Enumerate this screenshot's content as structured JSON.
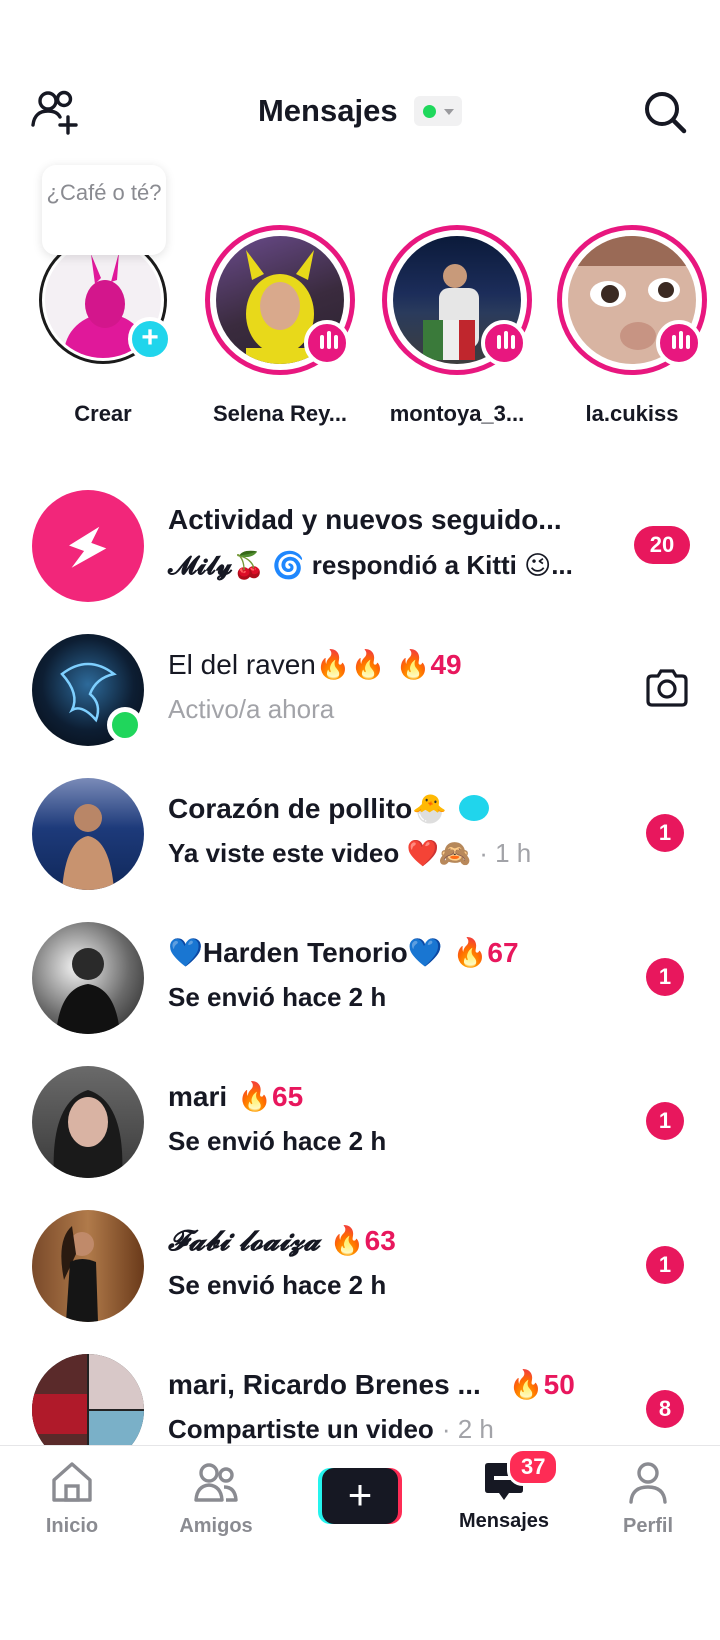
{
  "header": {
    "title": "Mensajes",
    "icons": [
      "add-friend-icon",
      "search-icon"
    ]
  },
  "stories": {
    "bubble": "¿Café o té?",
    "items": [
      {
        "name": "Crear",
        "type": "create"
      },
      {
        "name": "Selena Rey...",
        "type": "live"
      },
      {
        "name": "montoya_3...",
        "type": "live"
      },
      {
        "name": "la.cukiss",
        "type": "live"
      }
    ]
  },
  "conversations": [
    {
      "title": "Actividad y nuevos seguido...",
      "subtitle": "𝓜𝓲𝓵𝔂🍒 🌀 respondió a Kitti 😉...",
      "count": "20"
    },
    {
      "title": "El del raven🔥🔥",
      "streak": "🔥49",
      "subtitle": "Activo/a ahora",
      "online": true
    },
    {
      "title": "Corazón de pollito🐣",
      "subtitle": "Ya viste este video ❤️🙈",
      "time": "· 1 h",
      "count": "1"
    },
    {
      "title": "💙Harden Tenorio💙",
      "streak": "🔥67",
      "subtitle": "Se envió hace 2 h",
      "count": "1"
    },
    {
      "title": "mari",
      "streak": "🔥65",
      "subtitle": "Se envió hace 2 h",
      "count": "1"
    },
    {
      "title": "𝓕𝓪𝓫𝓲 𝓵𝓸𝓪𝓲𝔃𝓪",
      "streak": "🔥63",
      "subtitle": "Se envió hace 2 h",
      "count": "1"
    },
    {
      "title": "mari, Ricardo Brenes ...",
      "streak": "🔥50",
      "subtitle": "Compartiste un video",
      "time": "· 2 h",
      "count": "8"
    }
  ],
  "bottom_nav": {
    "tabs": [
      {
        "label": "Inicio"
      },
      {
        "label": "Amigos"
      },
      {
        "label": "Mensajes",
        "badge": "37",
        "active": true
      },
      {
        "label": "Perfil"
      }
    ]
  },
  "colors": {
    "accent": "#e8175d",
    "story_ring": "#e8177f",
    "online": "#20d65c",
    "create_badge": "#20d5ec"
  }
}
